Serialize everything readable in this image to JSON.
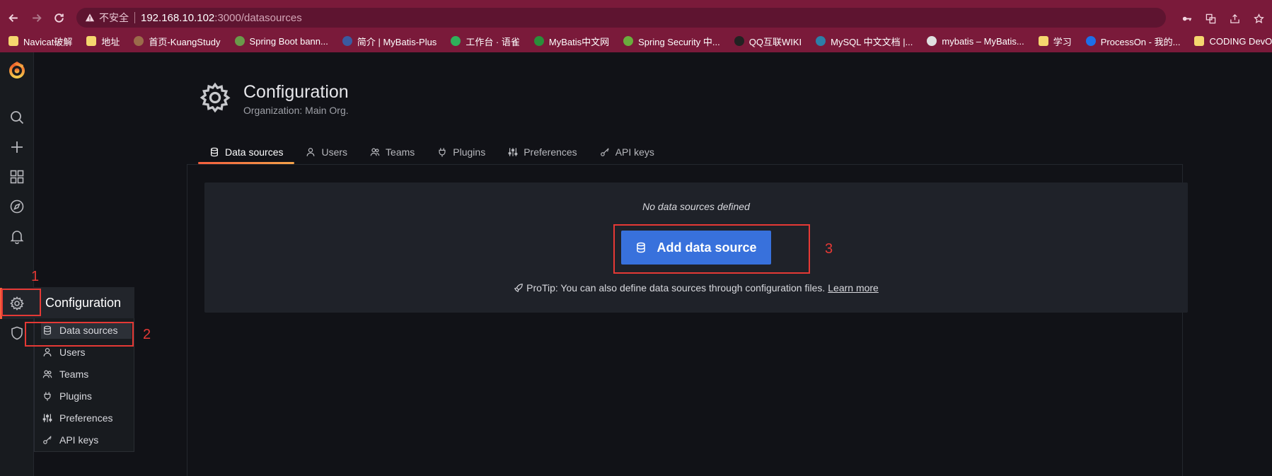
{
  "browser": {
    "insecure_label": "不安全",
    "url_host": "192.168.10.102",
    "url_rest": ":3000/datasources"
  },
  "bookmarks": [
    {
      "label": "Navicat破解",
      "icon": "folder-icon",
      "color": "#f5d76e"
    },
    {
      "label": "地址",
      "icon": "folder-icon",
      "color": "#f5d76e"
    },
    {
      "label": "首页-KuangStudy",
      "icon": "site-icon",
      "color": "#9b6b4a"
    },
    {
      "label": "Spring Boot bann...",
      "icon": "site-icon",
      "color": "#6a9a4a"
    },
    {
      "label": "简介 | MyBatis-Plus",
      "icon": "site-icon",
      "color": "#3a5aa0"
    },
    {
      "label": "工作台 · 语雀",
      "icon": "site-icon",
      "color": "#2fb15a"
    },
    {
      "label": "MyBatis中文网",
      "icon": "site-icon",
      "color": "#2a8f3a"
    },
    {
      "label": "Spring Security 中...",
      "icon": "site-icon",
      "color": "#6aad3d"
    },
    {
      "label": "QQ互联WIKI",
      "icon": "site-icon",
      "color": "#222222"
    },
    {
      "label": "MySQL 中文文档 |...",
      "icon": "site-icon",
      "color": "#2d7fa8"
    },
    {
      "label": "mybatis – MyBatis...",
      "icon": "site-icon",
      "color": "#e0e0e0"
    },
    {
      "label": "学习",
      "icon": "folder-icon",
      "color": "#f5d76e"
    },
    {
      "label": "ProcessOn - 我的...",
      "icon": "site-icon",
      "color": "#1e6fe8"
    },
    {
      "label": "CODING DevOps",
      "icon": "folder-icon",
      "color": "#f5d76e"
    }
  ],
  "page": {
    "title": "Configuration",
    "subtitle": "Organization: Main Org."
  },
  "tabs": [
    {
      "label": "Data sources",
      "icon": "database-icon",
      "active": true
    },
    {
      "label": "Users",
      "icon": "user-icon"
    },
    {
      "label": "Teams",
      "icon": "users-icon"
    },
    {
      "label": "Plugins",
      "icon": "plug-icon"
    },
    {
      "label": "Preferences",
      "icon": "sliders-icon"
    },
    {
      "label": "API keys",
      "icon": "key-icon"
    }
  ],
  "empty_state": {
    "message": "No data sources defined",
    "button_label": "Add data source",
    "protip_text": "ProTip: You can also define data sources through configuration files.",
    "protip_link": "Learn more"
  },
  "submenu": {
    "title": "Configuration",
    "items": [
      {
        "label": "Data sources",
        "icon": "database-icon"
      },
      {
        "label": "Users",
        "icon": "user-icon"
      },
      {
        "label": "Teams",
        "icon": "users-icon"
      },
      {
        "label": "Plugins",
        "icon": "plug-icon"
      },
      {
        "label": "Preferences",
        "icon": "sliders-icon"
      },
      {
        "label": "API keys",
        "icon": "key-icon"
      }
    ]
  },
  "annotations": [
    "1",
    "2",
    "3"
  ],
  "colors": {
    "browser_chrome": "#7a1a3a",
    "background": "#111217",
    "sidebar": "#181b1f",
    "primary_button": "#3871dc",
    "accent": "#f55f3e",
    "annotation_red": "#e53935"
  }
}
